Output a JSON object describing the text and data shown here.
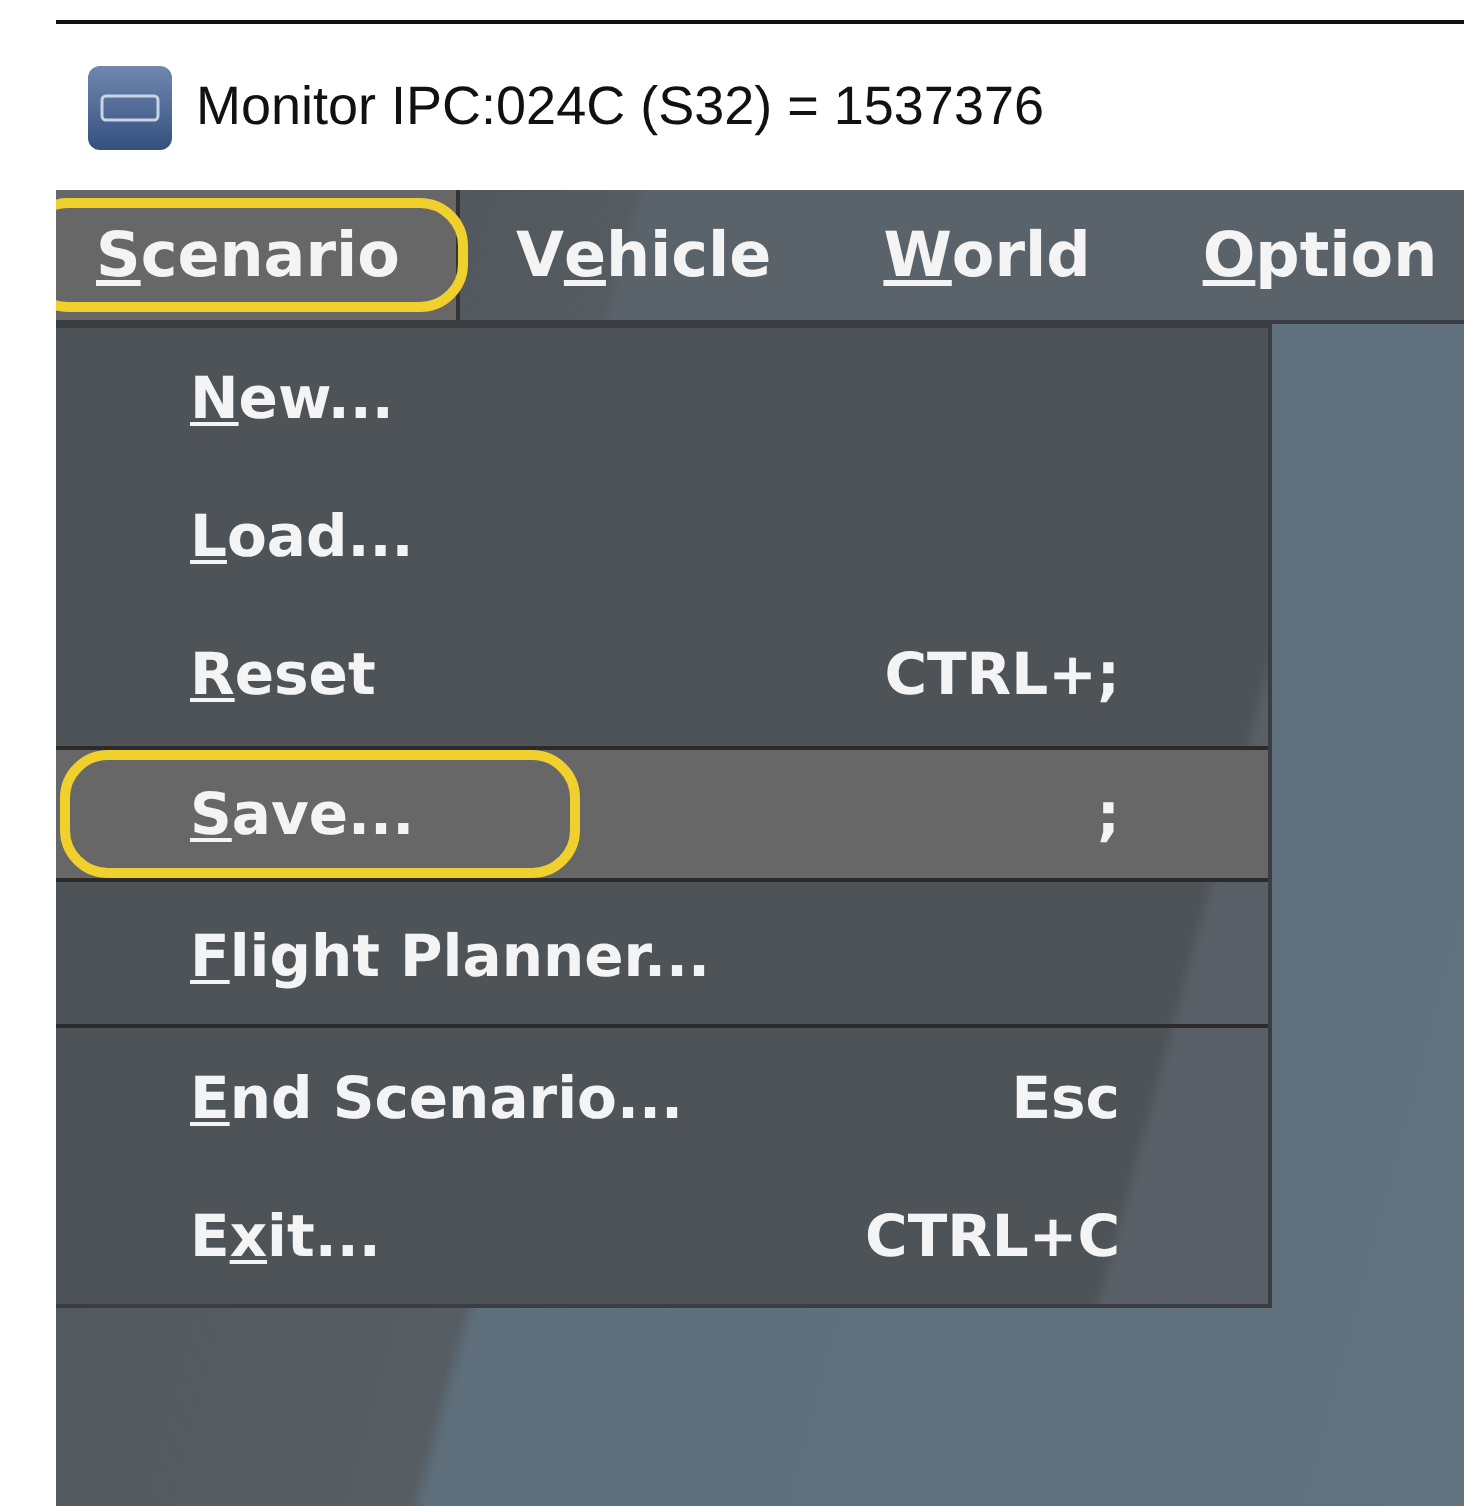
{
  "window": {
    "title": "Monitor IPC:024C (S32) = 1537376"
  },
  "menubar": [
    {
      "key": "S",
      "rest": "cenario",
      "selected": true,
      "annotated": true
    },
    {
      "lead": "V",
      "key": "e",
      "rest": "hicle",
      "selected": false,
      "annotated": false
    },
    {
      "key": "W",
      "rest": "orld",
      "selected": false,
      "annotated": false
    },
    {
      "key": "O",
      "rest": "ption",
      "selected": false,
      "annotated": false
    }
  ],
  "menu": [
    {
      "key": "N",
      "rest": "ew...",
      "selected": false,
      "annotated": false,
      "separator_after": false
    },
    {
      "key": "L",
      "rest": "oad...",
      "selected": false,
      "annotated": false,
      "separator_after": false
    },
    {
      "key": "R",
      "rest": "eset",
      "shortcut": "CTRL+;",
      "selected": false,
      "annotated": false,
      "separator_after": false
    },
    {
      "key": "S",
      "rest": "ave...",
      "shortcut": ";",
      "selected": true,
      "annotated": true,
      "separator_after": false
    },
    {
      "key": "F",
      "rest": "light Planner...",
      "selected": false,
      "annotated": false,
      "separator_after": true
    },
    {
      "key": "E",
      "rest": "nd Scenario...",
      "shortcut": "Esc",
      "selected": false,
      "annotated": false,
      "separator_after": false
    },
    {
      "lead": "E",
      "key": "x",
      "rest": "it...",
      "shortcut": "CTRL+C",
      "selected": false,
      "annotated": false,
      "separator_after": false
    }
  ]
}
